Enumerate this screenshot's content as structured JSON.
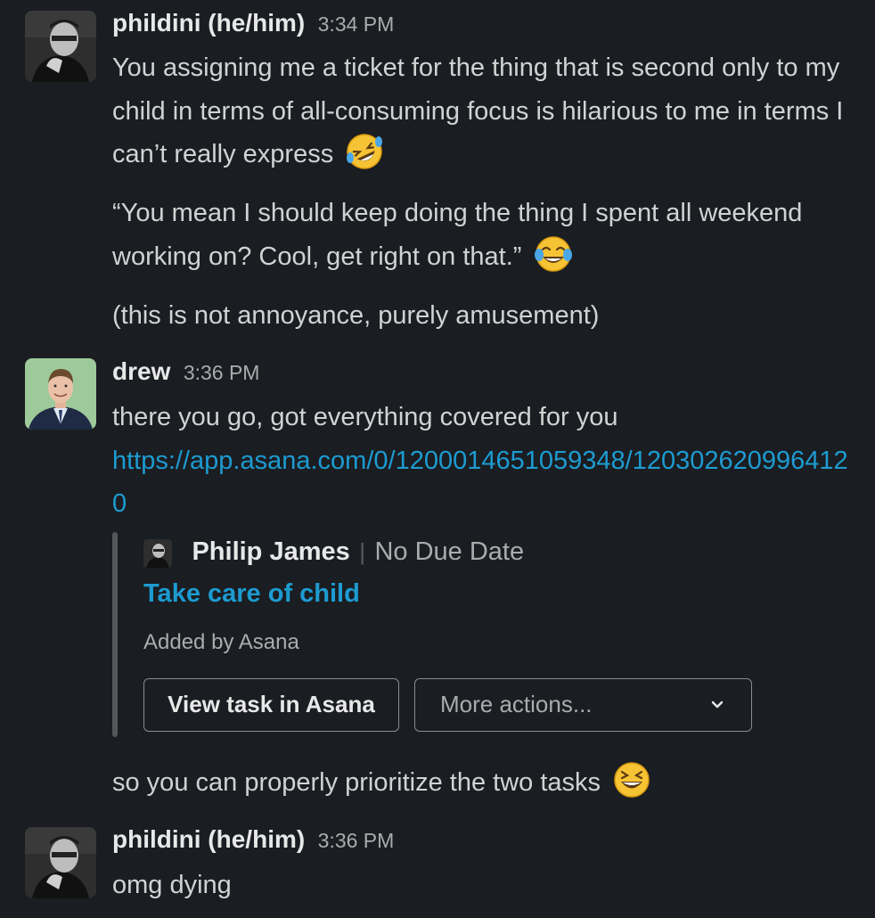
{
  "messages": [
    {
      "author": "phildini (he/him)",
      "time": "3:34 PM",
      "lines": [
        "You assigning me a ticket for the thing that is second only to my child in terms of all-consuming focus is hilarious to me in terms I can’t really express",
        "“You mean I should keep doing the thing I spent all weekend working on? Cool, get right on that.”",
        "(this is not annoyance, purely amusement)"
      ],
      "emojis": [
        "rolling-on-floor-laughing",
        "face-with-tears-of-joy"
      ]
    },
    {
      "author": "drew",
      "time": "3:36 PM",
      "text": "there you go, got everything covered for you",
      "link": "https://app.asana.com/0/1200014651059348/1203026209964120",
      "unfurl": {
        "assignee": "Philip James",
        "separator": "|",
        "due": "No Due Date",
        "task_title": "Take care of child",
        "added_by": "Added by Asana",
        "view_button": "View task in Asana",
        "more_actions": "More actions..."
      },
      "followup": "so you can properly prioritize the two tasks",
      "followup_emoji": "grinning-squinting-face"
    },
    {
      "author": "phildini (he/him)",
      "time": "3:36 PM",
      "text": "omg dying"
    }
  ],
  "colors": {
    "background": "#1a1d21",
    "text": "#d1d2d3",
    "link": "#1d9bd1",
    "timestamp": "#ababad",
    "unfurl_bar": "#545659"
  }
}
